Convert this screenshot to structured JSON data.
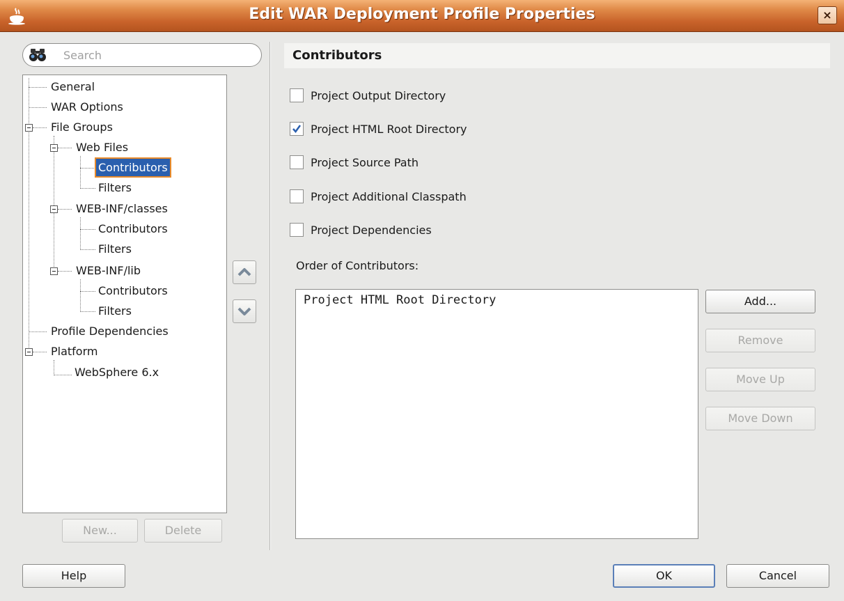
{
  "window": {
    "title": "Edit WAR Deployment Profile Properties",
    "close_label": "×"
  },
  "search": {
    "placeholder": "Search",
    "value": ""
  },
  "tree": {
    "items": [
      {
        "label": "General"
      },
      {
        "label": "WAR Options"
      },
      {
        "label": "File Groups"
      },
      {
        "label": "Web Files"
      },
      {
        "label": "Contributors",
        "selected": true
      },
      {
        "label": "Filters"
      },
      {
        "label": "WEB-INF/classes"
      },
      {
        "label": "Contributors"
      },
      {
        "label": "Filters"
      },
      {
        "label": "WEB-INF/lib"
      },
      {
        "label": "Contributors"
      },
      {
        "label": "Filters"
      },
      {
        "label": "Profile Dependencies"
      },
      {
        "label": "Platform"
      },
      {
        "label": "WebSphere 6.x"
      }
    ]
  },
  "tree_buttons": {
    "new_label": "New...",
    "delete_label": "Delete"
  },
  "panel": {
    "title": "Contributors",
    "checkboxes": [
      {
        "label": "Project Output Directory",
        "checked": false
      },
      {
        "label": "Project HTML Root Directory",
        "checked": true
      },
      {
        "label": "Project Source Path",
        "checked": false
      },
      {
        "label": "Project Additional Classpath",
        "checked": false
      },
      {
        "label": "Project Dependencies",
        "checked": false
      }
    ],
    "order_label": "Order of Contributors:",
    "order_items": [
      "Project HTML Root Directory"
    ],
    "buttons": {
      "add": "Add...",
      "remove": "Remove",
      "move_up": "Move Up",
      "move_down": "Move Down"
    }
  },
  "footer": {
    "help": "Help",
    "ok": "OK",
    "cancel": "Cancel"
  },
  "colors": {
    "titlebar": "#c8622a",
    "selection": "#2a5fae",
    "selection_outline": "#e88a2a",
    "checkmark": "#2a5fae"
  }
}
